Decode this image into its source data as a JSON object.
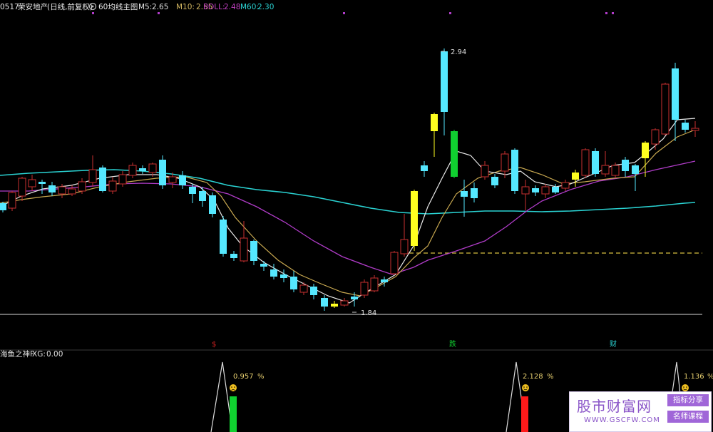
{
  "header": {
    "code": "0517",
    "name": "荣安地产",
    "period": "(日线,前复权)",
    "main_icon": "chart-circle-icon",
    "indicator_name": "60均线主图",
    "items": [
      {
        "label": "M5:",
        "value": "2.65",
        "color": "#e0e0e0"
      },
      {
        "label": "M10:",
        "value": "2.55",
        "color": "#d4b862"
      },
      {
        "label": "BOLL:",
        "value": "2.48",
        "color": "#c040c0"
      },
      {
        "label": "M60:",
        "value": "2.30",
        "color": "#2ad2d2"
      }
    ]
  },
  "chart": {
    "high_label": "2.94",
    "low_label": "1.84",
    "markers": [
      "$",
      "跌",
      "财"
    ],
    "colors": {
      "up": "#c83030",
      "down": "#55e8ff",
      "yellow": "#ffff20",
      "green": "#10d030",
      "m5": "#e0e0e0",
      "m10": "#d4b862",
      "boll": "#c040c0",
      "m60": "#2ad2d2",
      "dashed": "#d8c040"
    }
  },
  "sub": {
    "title": "海鱼之神F",
    "xg_label": "XG:",
    "xg_value": "0.00",
    "signals": [
      {
        "value": "0.957",
        "unit": "%",
        "icon": "sad-face-icon",
        "color": "#10d030"
      },
      {
        "value": "2.128",
        "unit": "%",
        "icon": "smile-face-icon",
        "color": "#ff1a1a"
      },
      {
        "value": "1.136",
        "unit": "%",
        "icon": "smile-face-icon",
        "color": "#10d030"
      }
    ]
  },
  "watermark": {
    "title": "股市财富网",
    "url": "WWW.GSCFW.COM",
    "tag1": "指标分享",
    "tag2": "名师课程"
  }
}
